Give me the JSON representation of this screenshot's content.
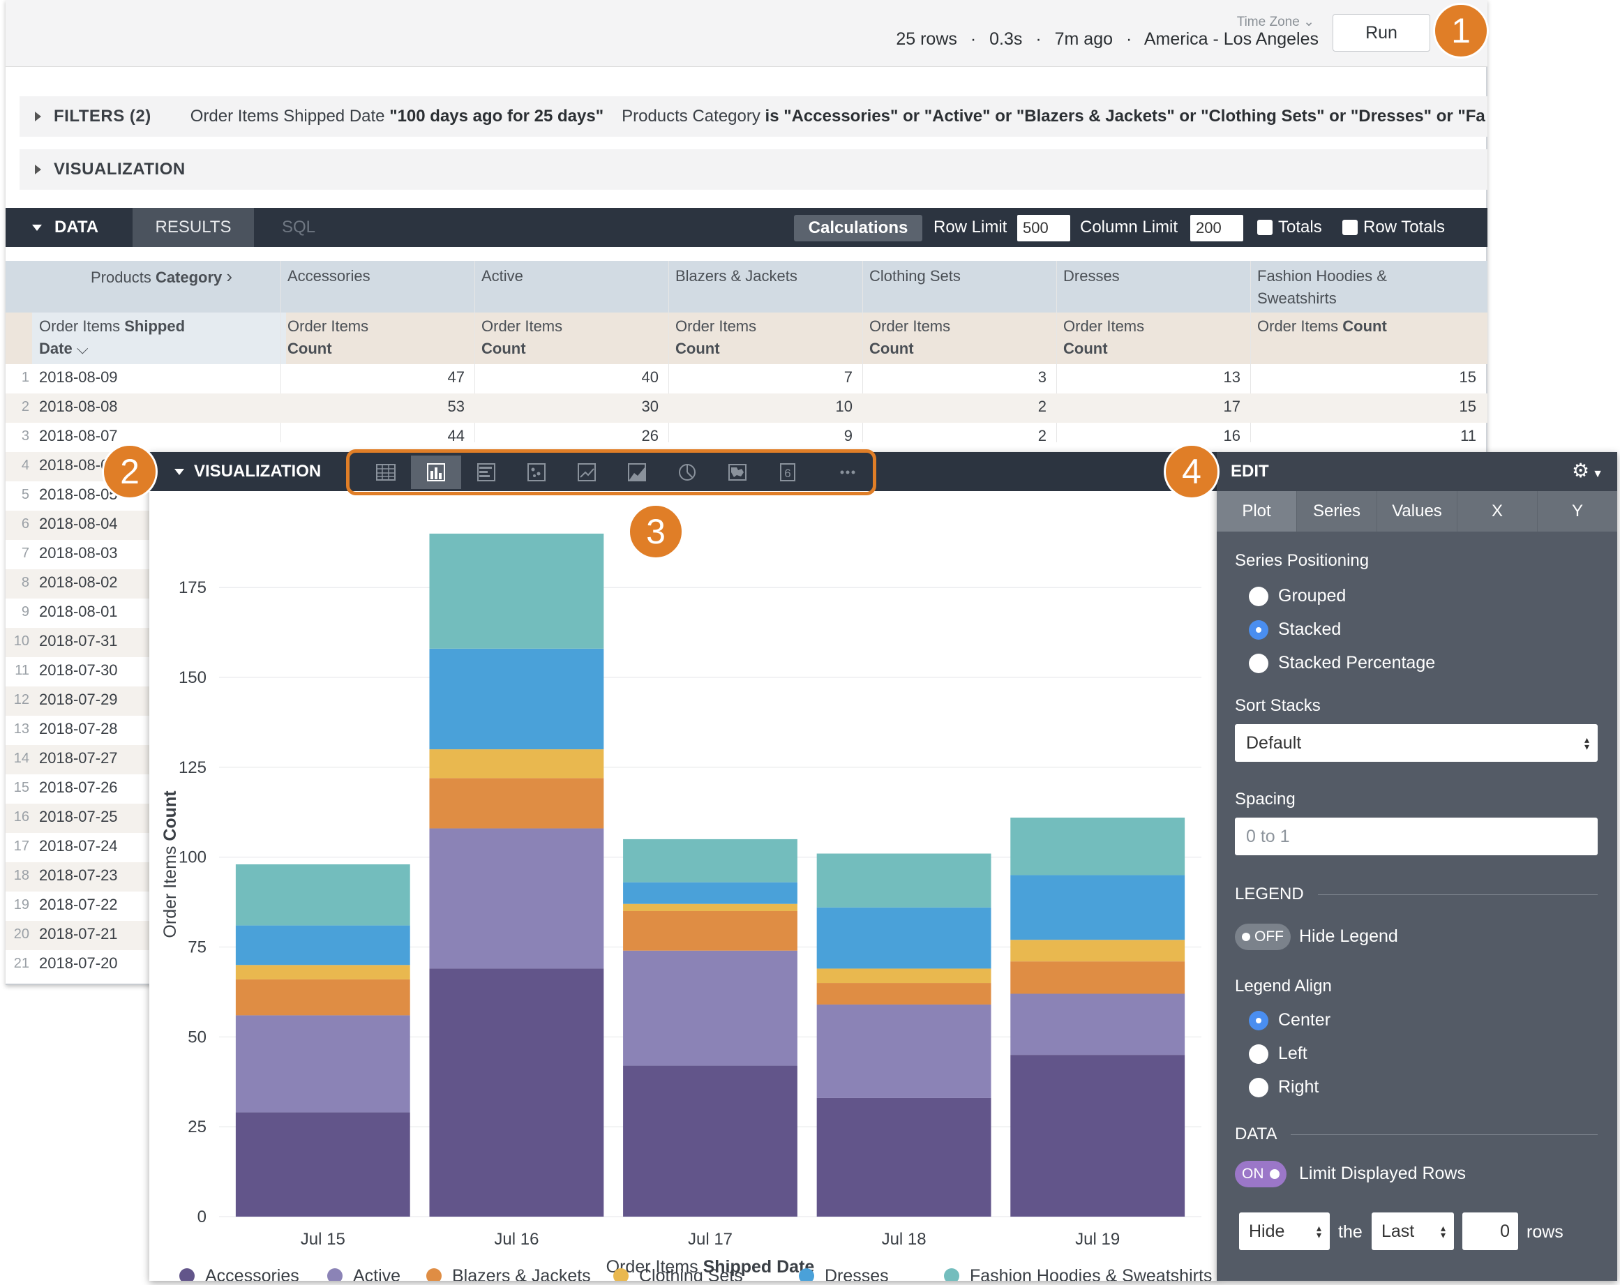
{
  "topbar": {
    "timezone_label": "Time Zone",
    "rows": "25 rows",
    "time": "0.3s",
    "ago": "7m ago",
    "timezone": "America - Los Angeles",
    "separator": "·",
    "run_label": "Run"
  },
  "badges": [
    "1",
    "2",
    "3",
    "4"
  ],
  "filters": {
    "title": "FILTERS (2)",
    "f1_field": "Order Items Shipped Date ",
    "f1_value": "\"100 days ago for 25 days\"",
    "f2_field": "Products Category ",
    "f2_value": "is \"Accessories\" or \"Active\" or \"Blazers & Jackets\" or \"Clothing Sets\" or \"Dresses\" or \"Fa"
  },
  "visualization_section": {
    "title": "VISUALIZATION"
  },
  "databar": {
    "title": "DATA",
    "results_tab": "RESULTS",
    "sql_tab": "SQL",
    "calculations": "Calculations",
    "row_limit_label": "Row Limit",
    "row_limit": "500",
    "column_limit_label": "Column Limit",
    "column_limit": "200",
    "totals_label": "Totals",
    "row_totals_label": "Row Totals"
  },
  "table": {
    "pivot_header": "Products Category",
    "pivot_header_bold": "Category",
    "pivot_header_prefix": "Products ",
    "categories": [
      "Accessories",
      "Active",
      "Blazers & Jackets",
      "Clothing Sets",
      "Dresses",
      "Fashion Hoodies & Sweatshirts"
    ],
    "row_header_line1_prefix": "Order Items ",
    "row_header_line1_bold": "Shipped",
    "row_header_line2_bold": "Date",
    "measure_prefix": "Order Items",
    "measure_bold": "Count",
    "rows": [
      {
        "num": "1",
        "date": "2018-08-09",
        "values": [
          "47",
          "40",
          "7",
          "3",
          "13",
          "15"
        ]
      },
      {
        "num": "2",
        "date": "2018-08-08",
        "values": [
          "53",
          "30",
          "10",
          "2",
          "17",
          "15"
        ]
      },
      {
        "num": "3",
        "date": "2018-08-07",
        "values": [
          "44",
          "26",
          "9",
          "2",
          "16",
          "11"
        ]
      },
      {
        "num": "4",
        "date": "2018-08-06",
        "values": []
      },
      {
        "num": "5",
        "date": "2018-08-05",
        "values": []
      },
      {
        "num": "6",
        "date": "2018-08-04",
        "values": []
      },
      {
        "num": "7",
        "date": "2018-08-03",
        "values": []
      },
      {
        "num": "8",
        "date": "2018-08-02",
        "values": []
      },
      {
        "num": "9",
        "date": "2018-08-01",
        "values": []
      },
      {
        "num": "10",
        "date": "2018-07-31",
        "values": []
      },
      {
        "num": "11",
        "date": "2018-07-30",
        "values": []
      },
      {
        "num": "12",
        "date": "2018-07-29",
        "values": []
      },
      {
        "num": "13",
        "date": "2018-07-28",
        "values": []
      },
      {
        "num": "14",
        "date": "2018-07-27",
        "values": []
      },
      {
        "num": "15",
        "date": "2018-07-26",
        "values": []
      },
      {
        "num": "16",
        "date": "2018-07-25",
        "values": []
      },
      {
        "num": "17",
        "date": "2018-07-24",
        "values": []
      },
      {
        "num": "18",
        "date": "2018-07-23",
        "values": []
      },
      {
        "num": "19",
        "date": "2018-07-22",
        "values": []
      },
      {
        "num": "20",
        "date": "2018-07-21",
        "values": []
      },
      {
        "num": "21",
        "date": "2018-07-20",
        "values": []
      }
    ]
  },
  "viz": {
    "title": "VISUALIZATION",
    "types": [
      "table-icon",
      "column-chart-icon",
      "bar-chart-icon",
      "scatter-icon",
      "line-chart-icon",
      "area-chart-icon",
      "pie-chart-icon",
      "map-icon",
      "single-value-icon",
      "more-icon"
    ],
    "selected_type": "column-chart-icon"
  },
  "chart_data": {
    "type": "bar",
    "stacked": true,
    "categories": [
      "Jul 15",
      "Jul 16",
      "Jul 17",
      "Jul 18",
      "Jul 19"
    ],
    "series": [
      {
        "name": "Accessories",
        "color": "#62558a",
        "values": [
          29,
          69,
          42,
          33,
          45
        ]
      },
      {
        "name": "Active",
        "color": "#8b83b6",
        "values": [
          27,
          39,
          32,
          26,
          17
        ]
      },
      {
        "name": "Blazers & Jackets",
        "color": "#df8d44",
        "values": [
          10,
          14,
          11,
          6,
          9
        ]
      },
      {
        "name": "Clothing Sets",
        "color": "#e9b84f",
        "values": [
          4,
          8,
          2,
          4,
          6
        ]
      },
      {
        "name": "Dresses",
        "color": "#4aa1d9",
        "values": [
          11,
          28,
          6,
          17,
          18
        ]
      },
      {
        "name": "Fashion Hoodies & Sweatshirts",
        "color": "#73bdbd",
        "values": [
          17,
          32,
          12,
          15,
          16
        ]
      }
    ],
    "xlabel_prefix": "Order Items ",
    "xlabel_bold": "Shipped Date",
    "ylabel_prefix": "Order Items ",
    "ylabel_bold": "Count",
    "yticks": [
      "0",
      "25",
      "50",
      "75",
      "100",
      "125",
      "150",
      "175"
    ],
    "ylim": [
      0,
      196
    ],
    "grid": true,
    "legend_position": "bottom"
  },
  "edit": {
    "title": "EDIT",
    "tabs": [
      "Plot",
      "Series",
      "Values",
      "X",
      "Y"
    ],
    "series_positioning_label": "Series Positioning",
    "positioning_options": [
      "Grouped",
      "Stacked",
      "Stacked Percentage"
    ],
    "positioning_selected": "Stacked",
    "sort_stacks_label": "Sort Stacks",
    "sort_stacks_value": "Default",
    "spacing_label": "Spacing",
    "spacing_placeholder": "0 to 1",
    "legend_section": "LEGEND",
    "hide_legend_toggle": "OFF",
    "hide_legend_label": "Hide Legend",
    "legend_align_label": "Legend Align",
    "legend_align_options": [
      "Center",
      "Left",
      "Right"
    ],
    "legend_align_selected": "Center",
    "data_section": "DATA",
    "limit_rows_toggle": "ON",
    "limit_rows_label": "Limit Displayed Rows",
    "hide_select": "Hide",
    "the_label": "the",
    "last_select": "Last",
    "rows_count": "0",
    "rows_label": "rows"
  }
}
